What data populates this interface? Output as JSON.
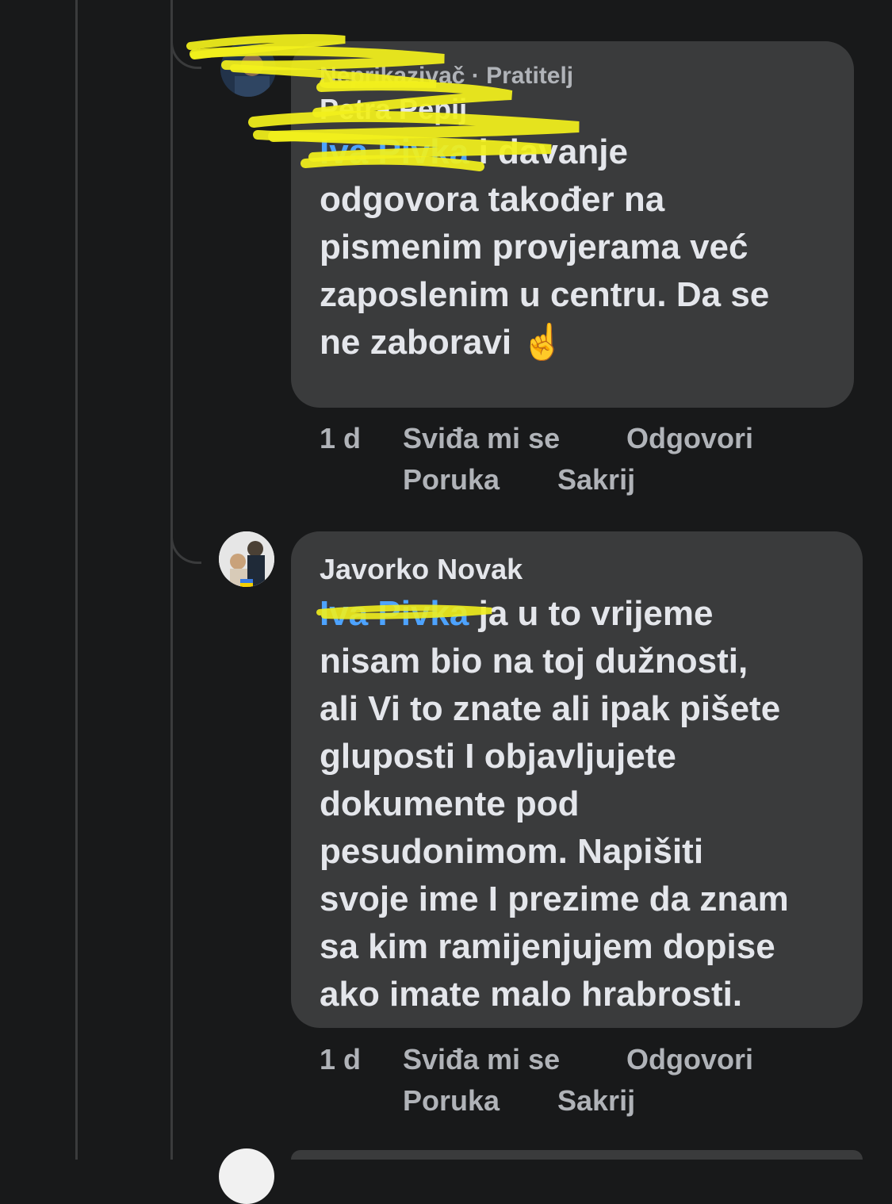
{
  "comments": [
    {
      "role_label": "Neprikazivač · Pratitelj",
      "author": "Petra Pepij",
      "mention": "Iva Pivka",
      "text_lines": [
        " i davanje",
        "odgovora također na",
        "pismenim provjerama već",
        "zaposlenim u centru.  Da se",
        "ne zaboravi ☝️"
      ],
      "time": "1 d",
      "like_label": "Sviđa mi se",
      "reply_label": "Odgovori",
      "message_label": "Poruka",
      "hide_label": "Sakrij"
    },
    {
      "author": "Javorko Novak",
      "mention": "Iva Pivka",
      "text_lines": [
        " ja u to vrijeme",
        "nisam bio na toj dužnosti,",
        "ali Vi to znate ali ipak pišete",
        "gluposti I objavljujete",
        "dokumente pod",
        "pesudonimom. Napišiti",
        "svoje ime I prezime da znam",
        "sa kim ramijenjujem dopise",
        "ako imate malo hrabrosti."
      ],
      "time": "1 d",
      "like_label": "Sviđa mi se",
      "reply_label": "Odgovori",
      "message_label": "Poruka",
      "hide_label": "Sakrij"
    }
  ],
  "colors": {
    "background": "#18191a",
    "bubble": "#3a3b3c",
    "text": "#e4e6eb",
    "secondary": "#b0b3b8",
    "mention": "#4da3ff",
    "highlighter": "#f2f01c"
  }
}
